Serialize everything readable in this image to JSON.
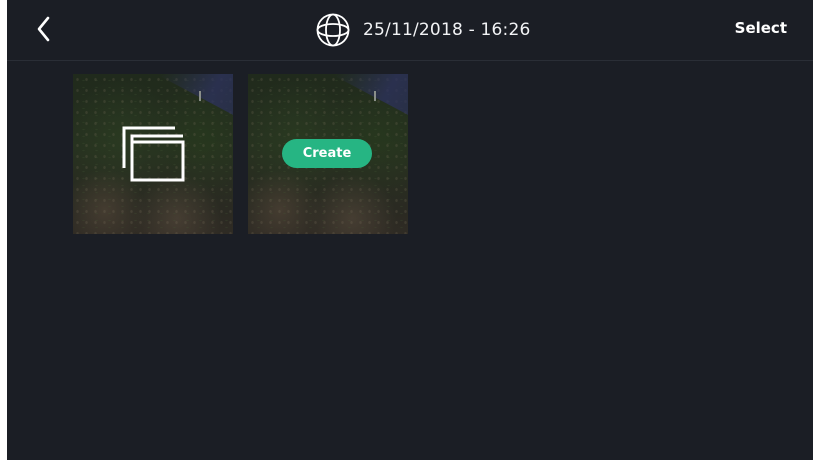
{
  "header": {
    "title": "25/11/2018 - 16:26",
    "select_label": "Select",
    "back_icon": "chevron-left-icon",
    "title_icon": "globe-icon"
  },
  "grid": {
    "tiles": [
      {
        "kind": "gallery",
        "icon": "multiple-images-icon"
      },
      {
        "kind": "photo",
        "action_label": "Create"
      }
    ]
  },
  "colors": {
    "background": "#1b1e25",
    "accent": "#26b583",
    "text": "#ffffff"
  }
}
